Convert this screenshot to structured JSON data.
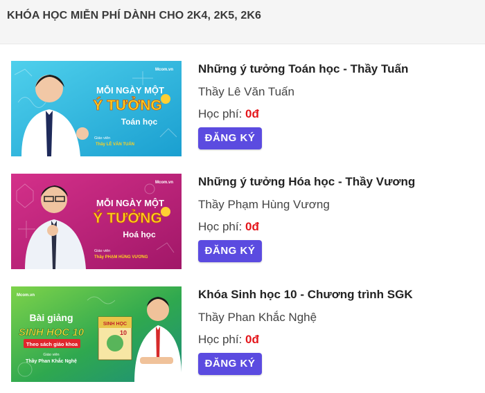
{
  "header": {
    "title": "KHÓA HỌC MIỄN PHÍ DÀNH CHO 2K4, 2K5, 2K6"
  },
  "courses": [
    {
      "title": "Những ý tưởng Toán học - Thầy Tuấn",
      "teacher": "Thầy Lê Văn Tuấn",
      "fee_label": "Học phí:",
      "fee_value": "0đ",
      "button": "ĐĂNG KÝ",
      "thumb": {
        "brand": "Mcom.vn",
        "line1": "MỖI NGÀY MỘT",
        "line2": "Ý TƯỞNG",
        "line3": "Toán học",
        "teacher_caption": "Giáo viên",
        "teacher_name": "Thầy LÊ VĂN TUẤN",
        "bg": "#22b5d8"
      }
    },
    {
      "title": "Những ý tưởng Hóa học - Thầy Vương",
      "teacher": "Thầy Phạm Hùng Vương",
      "fee_label": "Học phí:",
      "fee_value": "0đ",
      "button": "ĐĂNG KÝ",
      "thumb": {
        "brand": "Mcom.vn",
        "line1": "MỖI NGÀY MỘT",
        "line2": "Ý TƯỞNG",
        "line3": "Hoá học",
        "teacher_caption": "Giáo viên",
        "teacher_name": "Thầy PHẠM HÙNG VƯƠNG",
        "bg": "#b81e7a"
      }
    },
    {
      "title": "Khóa Sinh học 10 - Chương trình SGK",
      "teacher": "Thầy Phan Khắc Nghệ",
      "fee_label": "Học phí:",
      "fee_value": "0đ",
      "button": "ĐĂNG KÝ",
      "thumb": {
        "brand": "Mcom.vn",
        "line1": "Bài giảng",
        "line2": "SINH HỌC 10",
        "line3": "Theo sách giáo khoa",
        "teacher_caption": "Giáo viên",
        "teacher_name": "Thầy Phan Khắc Nghệ",
        "book_title": "SINH HỌC",
        "book_grade": "10",
        "bg": "#3fb24a"
      }
    }
  ]
}
